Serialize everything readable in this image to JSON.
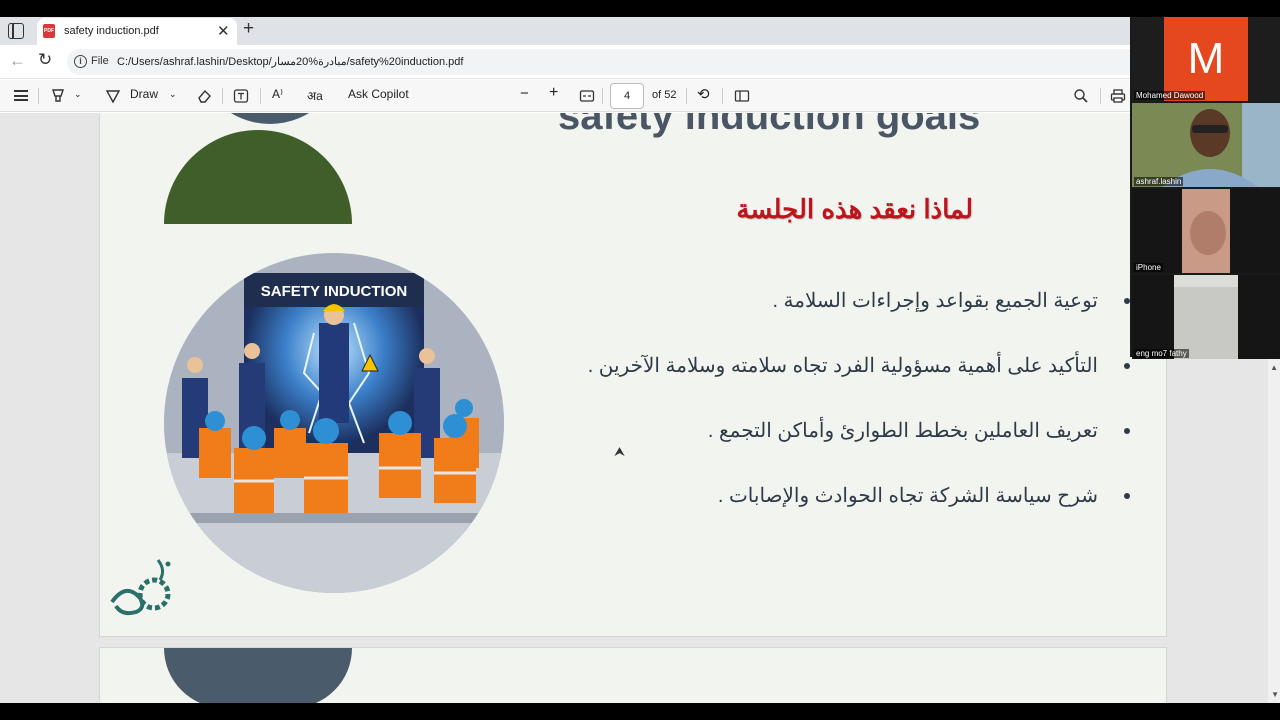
{
  "browser": {
    "tab_title": "safety induction.pdf",
    "tab_close": "✕",
    "new_tab": "+",
    "file_label": "File",
    "url": "C:/Users/ashraf.lashin/Desktop/مبادرة%20مسار/safety%20induction.pdf"
  },
  "pdf_toolbar": {
    "draw_label": "Draw",
    "ask_copilot_label": "Ask Copilot",
    "zoom_out": "−",
    "zoom_in": "+",
    "current_page": "4",
    "page_total": "of 52"
  },
  "slide": {
    "title": "safety induction goals",
    "subtitle": "لماذا نعقد هذه الجلسة",
    "bullets": [
      "توعية الجميع بقواعد وإجراءات السلامة .",
      "التأكيد على أهمية مسؤولية الفرد تجاه سلامته وسلامة الآخرين .",
      "تعريف العاملين بخطط الطوارئ وأماكن التجمع .",
      "شرح سياسة الشركة تجاه الحوادث والإصابات ."
    ],
    "image_caption": "SAFETY INDUCTION"
  },
  "participants": [
    {
      "name": "Mohamed Dawood",
      "initial": "M"
    },
    {
      "name": "ashraf.lashin"
    },
    {
      "name": "iPhone"
    },
    {
      "name": "eng mo7 fathy"
    }
  ],
  "colors": {
    "accent_red": "#c0141c",
    "slide_bg": "#f2f5ef",
    "semicircle_green": "#3f5e2a",
    "semicircle_slate": "#4a5b6b",
    "avatar_orange": "#e5471f"
  }
}
